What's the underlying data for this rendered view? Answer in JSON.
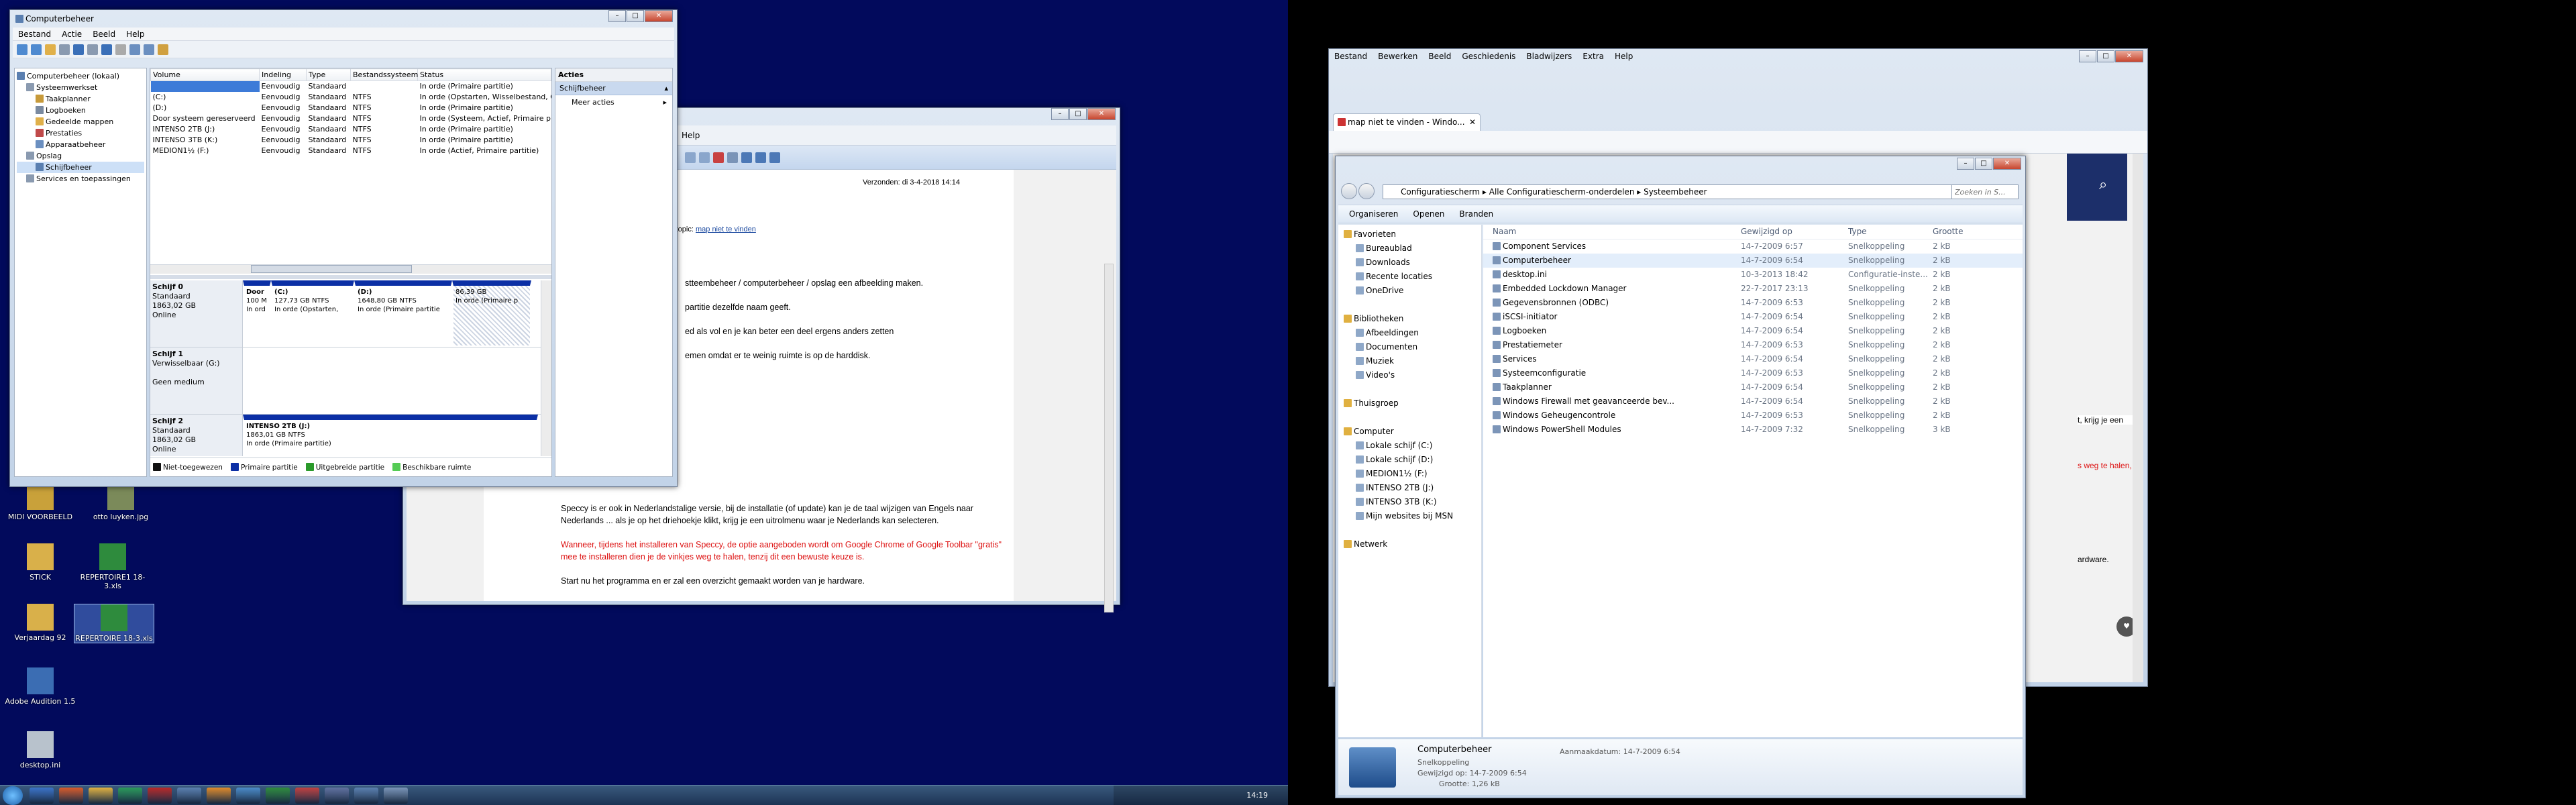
{
  "cm": {
    "title": "Computerbeheer",
    "menu": [
      "Bestand",
      "Actie",
      "Beeld",
      "Help"
    ],
    "tree": [
      {
        "label": "Computerbeheer (lokaal)",
        "indent": 0
      },
      {
        "label": "Systeemwerkset",
        "indent": 1
      },
      {
        "label": "Taakplanner",
        "indent": 2
      },
      {
        "label": "Logboeken",
        "indent": 2
      },
      {
        "label": "Gedeelde mappen",
        "indent": 2
      },
      {
        "label": "Prestaties",
        "indent": 2
      },
      {
        "label": "Apparaatbeheer",
        "indent": 2
      },
      {
        "label": "Opslag",
        "indent": 1
      },
      {
        "label": "Schijfbeheer",
        "indent": 2
      },
      {
        "label": "Services en toepassingen",
        "indent": 1
      }
    ],
    "cols": [
      "Volume",
      "Indeling",
      "Type",
      "Bestandssysteem",
      "Status"
    ],
    "rows": [
      [
        "",
        "Eenvoudig",
        "Standaard",
        "",
        "In orde (Primaire partitie)"
      ],
      [
        "(C:)",
        "Eenvoudig",
        "Standaard",
        "NTFS",
        "In orde (Opstarten, Wisselbestand, C"
      ],
      [
        "(D:)",
        "Eenvoudig",
        "Standaard",
        "NTFS",
        "In orde (Primaire partitie)"
      ],
      [
        "Door systeem gereserveerd",
        "Eenvoudig",
        "Standaard",
        "NTFS",
        "In orde (Systeem, Actief, Primaire p"
      ],
      [
        "INTENSO 2TB (J:)",
        "Eenvoudig",
        "Standaard",
        "NTFS",
        "In orde (Primaire partitie)"
      ],
      [
        "INTENSO 3TB (K:)",
        "Eenvoudig",
        "Standaard",
        "NTFS",
        "In orde (Primaire partitie)"
      ],
      [
        "MEDION1½ (F:)",
        "Eenvoudig",
        "Standaard",
        "NTFS",
        "In orde (Actief, Primaire partitie)"
      ]
    ],
    "actions": {
      "header": "Acties",
      "section": "Schijfbeheer",
      "more": "Meer acties"
    },
    "disk0": {
      "name": "Schijf 0",
      "type": "Standaard",
      "size": "1863,02 GB",
      "status": "Online",
      "parts": [
        {
          "name": "Door",
          "l2": "100 M",
          "l3": "In ord"
        },
        {
          "name": "(C:)",
          "l2": "127,73 GB NTFS",
          "l3": "In orde (Opstarten,"
        },
        {
          "name": "(D:)",
          "l2": "1648,80 GB NTFS",
          "l3": "In orde (Primaire partitie"
        },
        {
          "name": "",
          "l2": "86,39 GB",
          "l3": "In orde (Primaire p"
        }
      ]
    },
    "disk1": {
      "name": "Schijf 1",
      "type": "Verwisselbaar (G:)",
      "status": "Geen medium"
    },
    "disk2": {
      "name": "Schijf 2",
      "type": "Standaard",
      "size": "1863,02 GB",
      "status": "Online",
      "part": {
        "name": "INTENSO 2TB (J:)",
        "l2": "1863,01 GB NTFS",
        "l3": "In orde (Primaire partitie)"
      }
    },
    "legend": [
      "Niet-toegewezen",
      "Primaire partitie",
      "Uitgebreide partitie",
      "Beschikbare ruimte"
    ]
  },
  "desktop": {
    "icons": [
      "MIDI VOORBEELD",
      "otto luyken.jpg",
      "STICK",
      "REPERTOIRE1 18-3.xls",
      "Verjaardag 92",
      "REPERTOIRE 18-3.xls",
      "Adobe Audition 1.5",
      "desktop.ini"
    ],
    "taskbar_time": "14:19"
  },
  "forum": {
    "tab_label": "Help",
    "versonden": "Verzonden:",
    "date": "di 3-4-2018 14:14",
    "topic": "in topic:",
    "topic_link": "map niet te vinden",
    "lines": [
      "stteembeheer / computerbeheer / opslag een afbeelding maken.",
      "partitie dezelfde naam geeft.",
      "ed als vol en je kan beter een deel ergens anders zetten",
      "emen omdat er te weinig ruimte is op de harddisk."
    ],
    "p1": "Speccy is er ook in Nederlandstalige versie, bij de installatie (of update) kan je de taal wijzigen van Engels naar Nederlands ... als je op het driehoekje klikt, krijg je een uitrolmenu waar je Nederlands kan selecteren.",
    "p2": "Wanneer, tijdens het installeren van Speccy, de optie aangeboden wordt om Google Chrome of Google Toolbar \"gratis\" mee te installeren dien je de vinkjes weg te halen, tenzij dit een bewuste keuze is.",
    "p3": "Start nu het programma en er zal een overzicht gemaakt worden van je hardware."
  },
  "firefox": {
    "menu": [
      "Bestand",
      "Bewerken",
      "Beeld",
      "Geschiedenis",
      "Bladwijzers",
      "Extra",
      "Help"
    ],
    "tab": "map niet te vinden - Windo...",
    "frag1": "t, krijg je een",
    "frag2": "s weg te halen,",
    "frag3": "ardware."
  },
  "explorer": {
    "breadcrumb": [
      "Configuratiescherm",
      "Alle Configuratiescherm-onderdelen",
      "Systeembeheer"
    ],
    "search_placeholder": "Zoeken in S...",
    "toolbar": [
      "Organiseren",
      "Openen",
      "Branden"
    ],
    "nav": [
      {
        "label": "Favorieten",
        "indent": 0
      },
      {
        "label": "Bureaublad",
        "indent": 1
      },
      {
        "label": "Downloads",
        "indent": 1
      },
      {
        "label": "Recente locaties",
        "indent": 1
      },
      {
        "label": "OneDrive",
        "indent": 1
      },
      {
        "label": "",
        "indent": 0
      },
      {
        "label": "Bibliotheken",
        "indent": 0
      },
      {
        "label": "Afbeeldingen",
        "indent": 1
      },
      {
        "label": "Documenten",
        "indent": 1
      },
      {
        "label": "Muziek",
        "indent": 1
      },
      {
        "label": "Video's",
        "indent": 1
      },
      {
        "label": "",
        "indent": 0
      },
      {
        "label": "Thuisgroep",
        "indent": 0
      },
      {
        "label": "",
        "indent": 0
      },
      {
        "label": "Computer",
        "indent": 0
      },
      {
        "label": "Lokale schijf (C:)",
        "indent": 1
      },
      {
        "label": "Lokale schijf (D:)",
        "indent": 1
      },
      {
        "label": "MEDION1½ (F:)",
        "indent": 1
      },
      {
        "label": "INTENSO 2TB (J:)",
        "indent": 1
      },
      {
        "label": "INTENSO 3TB (K:)",
        "indent": 1
      },
      {
        "label": "Mijn websites bij MSN",
        "indent": 1
      },
      {
        "label": "",
        "indent": 0
      },
      {
        "label": "Netwerk",
        "indent": 0
      }
    ],
    "cols": [
      "Naam",
      "Gewijzigd op",
      "Type",
      "Grootte"
    ],
    "rows": [
      [
        "Component Services",
        "14-7-2009 6:57",
        "Snelkoppeling",
        "2 kB"
      ],
      [
        "Computerbeheer",
        "14-7-2009 6:54",
        "Snelkoppeling",
        "2 kB"
      ],
      [
        "desktop.ini",
        "10-3-2013 18:42",
        "Configuratie-inste...",
        "2 kB"
      ],
      [
        "Embedded Lockdown Manager",
        "22-7-2017 23:13",
        "Snelkoppeling",
        "2 kB"
      ],
      [
        "Gegevensbronnen (ODBC)",
        "14-7-2009 6:53",
        "Snelkoppeling",
        "2 kB"
      ],
      [
        "iSCSI-initiator",
        "14-7-2009 6:54",
        "Snelkoppeling",
        "2 kB"
      ],
      [
        "Logboeken",
        "14-7-2009 6:54",
        "Snelkoppeling",
        "2 kB"
      ],
      [
        "Prestatiemeter",
        "14-7-2009 6:53",
        "Snelkoppeling",
        "2 kB"
      ],
      [
        "Services",
        "14-7-2009 6:54",
        "Snelkoppeling",
        "2 kB"
      ],
      [
        "Systeemconfiguratie",
        "14-7-2009 6:53",
        "Snelkoppeling",
        "2 kB"
      ],
      [
        "Taakplanner",
        "14-7-2009 6:54",
        "Snelkoppeling",
        "2 kB"
      ],
      [
        "Windows Firewall met geavanceerde bev...",
        "14-7-2009 6:54",
        "Snelkoppeling",
        "2 kB"
      ],
      [
        "Windows Geheugencontrole",
        "14-7-2009 6:53",
        "Snelkoppeling",
        "2 kB"
      ],
      [
        "Windows PowerShell Modules",
        "14-7-2009 7:32",
        "Snelkoppeling",
        "3 kB"
      ]
    ],
    "details": {
      "name": "Computerbeheer",
      "type": "Snelkoppeling",
      "modified_label": "Gewijzigd op:",
      "modified": "14-7-2009 6:54",
      "size_label": "Grootte:",
      "size": "1,26 kB",
      "created_label": "Aanmaakdatum:",
      "created": "14-7-2009 6:54"
    }
  }
}
